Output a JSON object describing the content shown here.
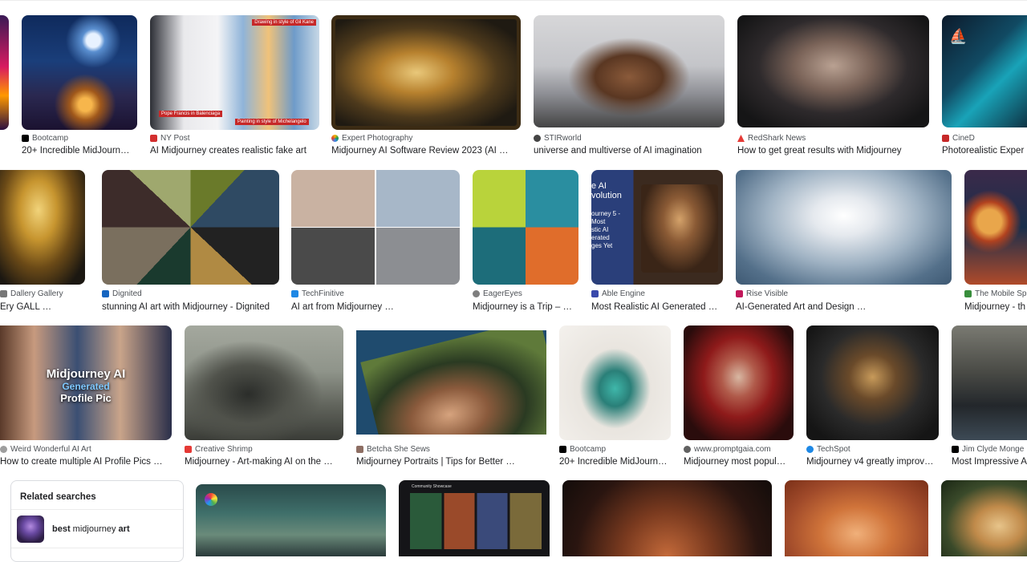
{
  "row1": [
    {
      "source": "Bootcamp",
      "title": "20+ Incredible MidJourn…",
      "fav": "#000000"
    },
    {
      "source": "NY Post",
      "title": "AI Midjourney creates realistic fake art",
      "fav": "#d32f2f",
      "overlay_top": "Drawing in style of Gil Kane",
      "overlay_left": "Pope Francis in Balenciaga",
      "overlay_right": "Painting in style of Michelangelo"
    },
    {
      "source": "Expert Photography",
      "title": "Midjourney AI Software Review 2023 (AI …",
      "fav": "#f4b400"
    },
    {
      "source": "STIRworld",
      "title": "universe and multiverse of AI imagination",
      "fav": "#444444"
    },
    {
      "source": "RedShark News",
      "title": "How to get great results with Midjourney",
      "fav": "#e53935"
    },
    {
      "source": "CineD",
      "title": "Photorealistic Exper",
      "fav": "#c62828"
    }
  ],
  "row2": [
    {
      "source": "Dallery Gallery",
      "title": "Ery GALL …",
      "fav": "#777777"
    },
    {
      "source": "Dignited",
      "title": "stunning AI art with Midjourney - Dignited",
      "fav": "#1565c0"
    },
    {
      "source": "TechFinitive",
      "title": "AI art from Midjourney …",
      "fav": "#1e88e5"
    },
    {
      "source": "EagerEyes",
      "title": "Midjourney is a Trip – …",
      "fav": "#7e7e7e"
    },
    {
      "source": "Able Engine",
      "title": "Most Realistic AI Generated I…",
      "fav": "#3949ab",
      "overlay_lines": [
        "e AI",
        "volution",
        "ourney 5 -",
        "Most",
        "stic AI",
        "erated",
        "ges Yet"
      ]
    },
    {
      "source": "Rise Visible",
      "title": "AI-Generated Art and Design …",
      "fav": "#c2185b"
    },
    {
      "source": "The Mobile Sp",
      "title": "Midjourney - th",
      "fav": "#388e3c"
    }
  ],
  "row3": [
    {
      "source": "Weird Wonderful AI Art",
      "title": "How to create multiple AI Profile Pics …",
      "fav": "#9e9e9e",
      "overlay_lines": [
        "Midjourney AI",
        "Generated",
        "Profile Pic"
      ]
    },
    {
      "source": "Creative Shrimp",
      "title": "Midjourney - Art-making AI on the R…",
      "fav": "#e53935"
    },
    {
      "source": "Betcha She Sews",
      "title": "Midjourney Portraits | Tips for Better …",
      "fav": "#8d6e63"
    },
    {
      "source": "Bootcamp",
      "title": "20+ Incredible MidJourn…",
      "fav": "#000000"
    },
    {
      "source": "www.promptgaia.com",
      "title": "Midjourney most popul…",
      "fav": "#616161"
    },
    {
      "source": "TechSpot",
      "title": "Midjourney v4 greatly improv…",
      "fav": "#1e88e5"
    },
    {
      "source": "Jim Clyde Monge",
      "title": "Most Impressive A",
      "fav": "#000000"
    }
  ],
  "row4": {
    "overlay": "Community Showcase"
  },
  "related": {
    "heading": "Related searches",
    "item_bold_1": "best",
    "item_plain": " midjourney ",
    "item_bold_2": "art"
  },
  "colors": {
    "accent": "#1a73e8",
    "border": "#dadce0"
  }
}
